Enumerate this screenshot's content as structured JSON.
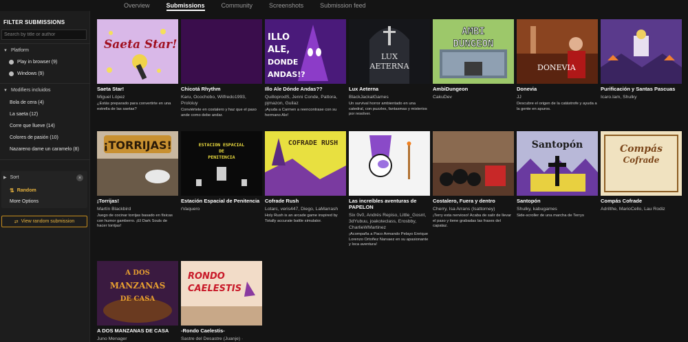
{
  "nav": {
    "tabs": [
      {
        "label": "Overview",
        "active": false
      },
      {
        "label": "Submissions",
        "active": true
      },
      {
        "label": "Community",
        "active": false
      },
      {
        "label": "Screenshots",
        "active": false
      },
      {
        "label": "Submission feed",
        "active": false
      }
    ]
  },
  "sidebar": {
    "title": "FILTER SUBMISSIONS",
    "search_placeholder": "Search by title or author",
    "platform": {
      "label": "Platform",
      "options": [
        "Play in browser (9)",
        "Windows (9)"
      ]
    },
    "modifiers": {
      "label": "Modifiers incluidos",
      "items": [
        "Bola de cera (4)",
        "La saeta (12)",
        "Corre que llueve (14)",
        "Colores de pasión (10)",
        "Nazareno dame un caramelo (8)"
      ]
    },
    "sort": {
      "label": "Sort",
      "clear_icon": "×",
      "value": "Random",
      "more_options": "More Options"
    },
    "view_random": "View random submission",
    "accent": "#e8b33e"
  },
  "cards": [
    {
      "title": "Saeta Star!",
      "authors": "Miguel López",
      "desc": "¿Estás preparado para convertirte en una estrella de las saetas?",
      "thumb": "saeta"
    },
    {
      "title": "Chicotá Rhythm",
      "authors": "Karu, Ocochobo, Wilfredo1993, Proloiuy",
      "desc": "Conviértete en costalero y haz que el paso ande como debe andar.",
      "thumb": "chicota"
    },
    {
      "title": "Illo Ale Dónde Andas??",
      "authors": "QuilloprodS, Jenni Conde, Pattora, pjmazon, Guilaz",
      "desc": "¡Ayuda a Carmen a reencontrase con su hermano Ale!",
      "thumb": "illo",
      "thumb_text": "ILLO ALE, DONDE ANDAS!?"
    },
    {
      "title": "Lux Aeterna",
      "authors": "BlackJackalGames",
      "desc": "Un survival horror ambientado en una catedral, con puzzles, fantasmas y misterios por resolver.",
      "thumb": "lux",
      "thumb_text": "LUX AETERNA"
    },
    {
      "title": "AmbiDungeon",
      "authors": "CakuDev",
      "desc": "",
      "thumb": "ambi",
      "thumb_text": "AMBI DUNGEON"
    },
    {
      "title": "Donevia",
      "authors": "JJ",
      "desc": "Descubre el origen de la catástrofe y ayuda a la gente en apuros.",
      "thumb": "donevia",
      "thumb_text": "DONEVIA"
    },
    {
      "title": "Purificación y Santas Pascuas",
      "authors": "Icaro.Iam, Shulky",
      "desc": "",
      "thumb": "puri"
    },
    {
      "title": "¡Torrijas!",
      "authors": "Martín Blackbird",
      "desc": "Juego de cocinar torrijas basado en físicas con humor gamberro. ¡El Dark Souls de hacer torrijas!",
      "thumb": "torrijas",
      "thumb_text": "¡TORRIJAS!"
    },
    {
      "title": "Estación Espacial de Penitencia",
      "authors": "rVaquero",
      "desc": "",
      "thumb": "estacion",
      "thumb_text": "ESTACION ESPACIAL DE PENITENCIA"
    },
    {
      "title": "Cofrade Rush",
      "authors": "Lotarc, veris447, Diego, LaMarrash",
      "desc": "Holy Rush is an arcade game inspired by Totally accurate battle simulator.",
      "thumb": "cofrade",
      "thumb_text": "COFRADE RUSH"
    },
    {
      "title": "Las increíbles aventuras de PAPELON",
      "authors": "Six 0v0, Andrés Repiso, Little_Gosnt, 3dYubuu, joakoteclass, Erosbby, CharlieWMartinez",
      "desc": "¡Acompaña a Paco Armando Pelayo Enrique Lorenzo Ortoñez Narvaez en su apasionante y loca aventura!",
      "thumb": "papelon"
    },
    {
      "title": "Costalero, Fuera y dentro",
      "authors": "Cherry, Isa Arrans (Isattorney)",
      "desc": "¡Terry esta nervioso! Acaba de salir de llevar el paso y tiene grabadas las frases del capataz.",
      "thumb": "costalero"
    },
    {
      "title": "Santopón",
      "authors": "Shulky, kabugames",
      "desc": "Side-scroller de una marcha de Terrys",
      "thumb": "santopon",
      "thumb_text": "Santopón"
    },
    {
      "title": "Compás Cofrade",
      "authors": "Adrilthe, MarioCello, Lau Rodiz",
      "desc": "",
      "thumb": "compas",
      "thumb_text": "Compás Cofrade"
    },
    {
      "title": "A DOS MANZANAS DE CASA",
      "authors": "Juno Menager",
      "desc": "",
      "thumb": "manzanas",
      "thumb_text": "A DOS MANZANAS DE CASA"
    },
    {
      "title": "-Rondo Caelestis-",
      "authors": "Sastre del Desastre (Juanje) ·",
      "desc": "",
      "thumb": "rondo",
      "thumb_text": "RONDO CAELESTIS"
    }
  ]
}
